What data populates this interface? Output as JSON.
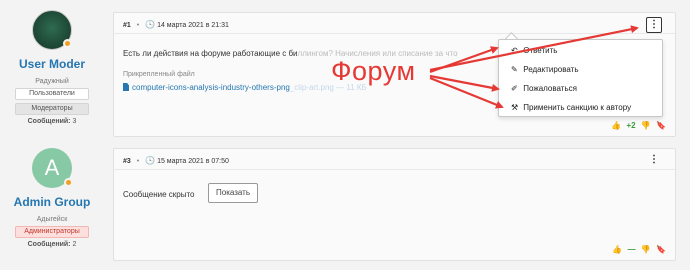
{
  "users": [
    {
      "avatar_letter": "",
      "name": "User Moder",
      "title": "Радужный",
      "badges": [
        "Пользователи",
        "Модераторы"
      ],
      "messages_label": "Сообщений:",
      "messages_count": "3"
    },
    {
      "avatar_letter": "A",
      "name": "Admin Group",
      "title": "Адыгейск",
      "badges": [
        "Администраторы"
      ],
      "messages_label": "Сообщений:",
      "messages_count": "2"
    }
  ],
  "posts": [
    {
      "number": "#1",
      "date": "14 марта 2021 в 21:31",
      "text_visible": "Есть ли действия на форуме работающие с би",
      "text_faded": "ллингом? Начисления или списание за что",
      "attachment_label": "Прикрепленный файл",
      "attachment_name": "computer-icons-analysis-industry-others-png",
      "attachment_name_faded": "_clip-art.png",
      "attachment_size": "—  11 КБ",
      "reaction_count": "+2"
    },
    {
      "number": "#3",
      "date": "15 марта 2021 в 07:50",
      "hidden_text": "Сообщение скрыто",
      "show_button": "Показать",
      "reaction_count": "—"
    }
  ],
  "menu": {
    "items": [
      {
        "label": "Ответить",
        "icon": "reply-icon",
        "glyph": "↶"
      },
      {
        "label": "Редактировать",
        "icon": "edit-icon",
        "glyph": "✎"
      },
      {
        "label": "Пожаловаться",
        "icon": "flag-icon",
        "glyph": "✐"
      },
      {
        "label": "Применить санкцию к автору",
        "icon": "gavel-icon",
        "glyph": "⚒"
      }
    ]
  },
  "annotation": {
    "label": "Форум",
    "color": "#e53935"
  },
  "colors": {
    "link": "#2577b1",
    "positive": "#3a9a3a",
    "negative": "#d9362b",
    "admin_badge": "#fde0de"
  }
}
